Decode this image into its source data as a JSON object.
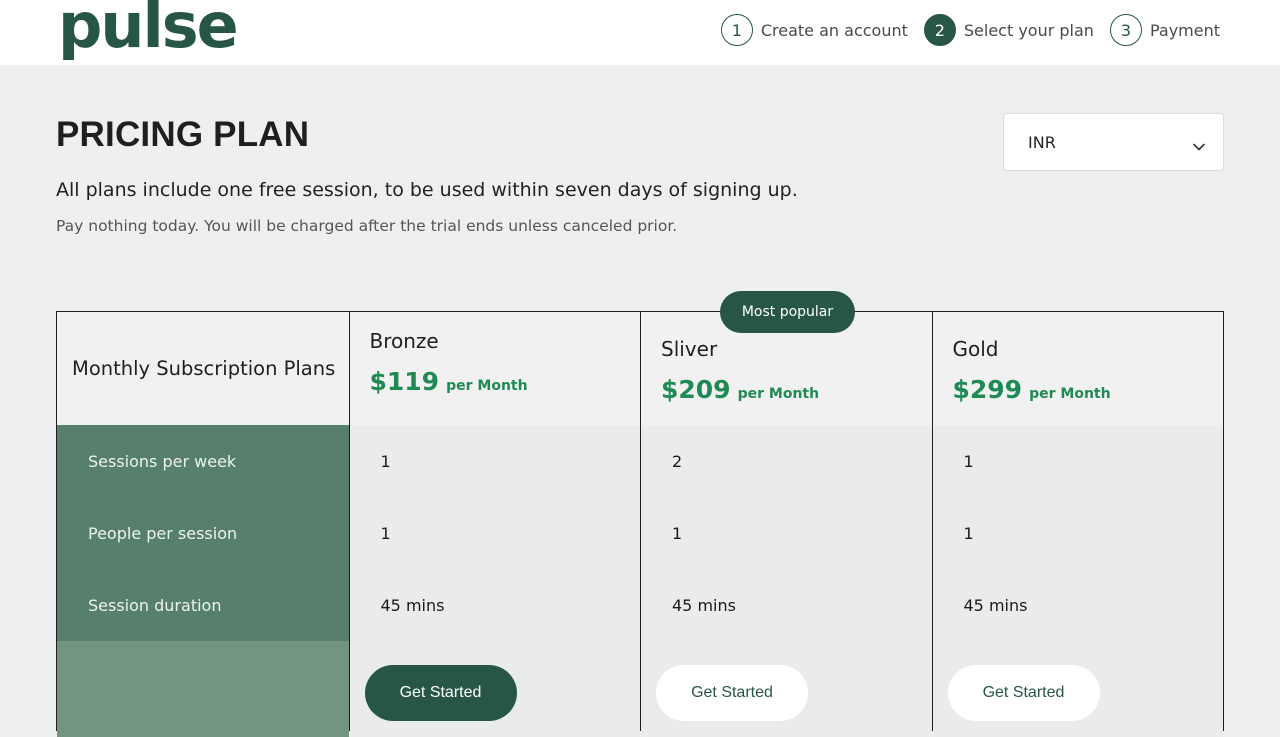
{
  "brand": {
    "logo_text": "pulse",
    "color": "#275744"
  },
  "steps": [
    {
      "num": "1",
      "label": "Create an account",
      "active": false
    },
    {
      "num": "2",
      "label": "Select your plan",
      "active": true
    },
    {
      "num": "3",
      "label": "Payment",
      "active": false
    }
  ],
  "page": {
    "title": "PRICING PLAN",
    "subtitle": "All plans include one free session, to be used within seven days of signing up.",
    "note": "Pay nothing today. You will be charged after the trial ends unless canceled prior."
  },
  "currency_select": {
    "value": "INR",
    "icon": "chevron-down-icon"
  },
  "table": {
    "header_label": "Monthly Subscription Plans",
    "row_labels": [
      "Sessions per week",
      "People per session",
      "Session duration"
    ],
    "badge": "Most popular",
    "plans": [
      {
        "name": "Bronze",
        "price": "$119",
        "period": "per Month",
        "values": [
          "1",
          "1",
          "45 mins"
        ],
        "cta": "Get Started"
      },
      {
        "name": "Sliver",
        "price": "$209",
        "period": "per Month",
        "values": [
          "2",
          "1",
          "45 mins"
        ],
        "cta": "Get Started"
      },
      {
        "name": "Gold",
        "price": "$299",
        "period": "per Month",
        "values": [
          "1",
          "1",
          "45 mins"
        ],
        "cta": "Get Started"
      }
    ]
  },
  "colors": {
    "accent": "#275744",
    "price": "#1f8a54",
    "label_column": "#567f6c",
    "footer_label": "#73947f"
  }
}
